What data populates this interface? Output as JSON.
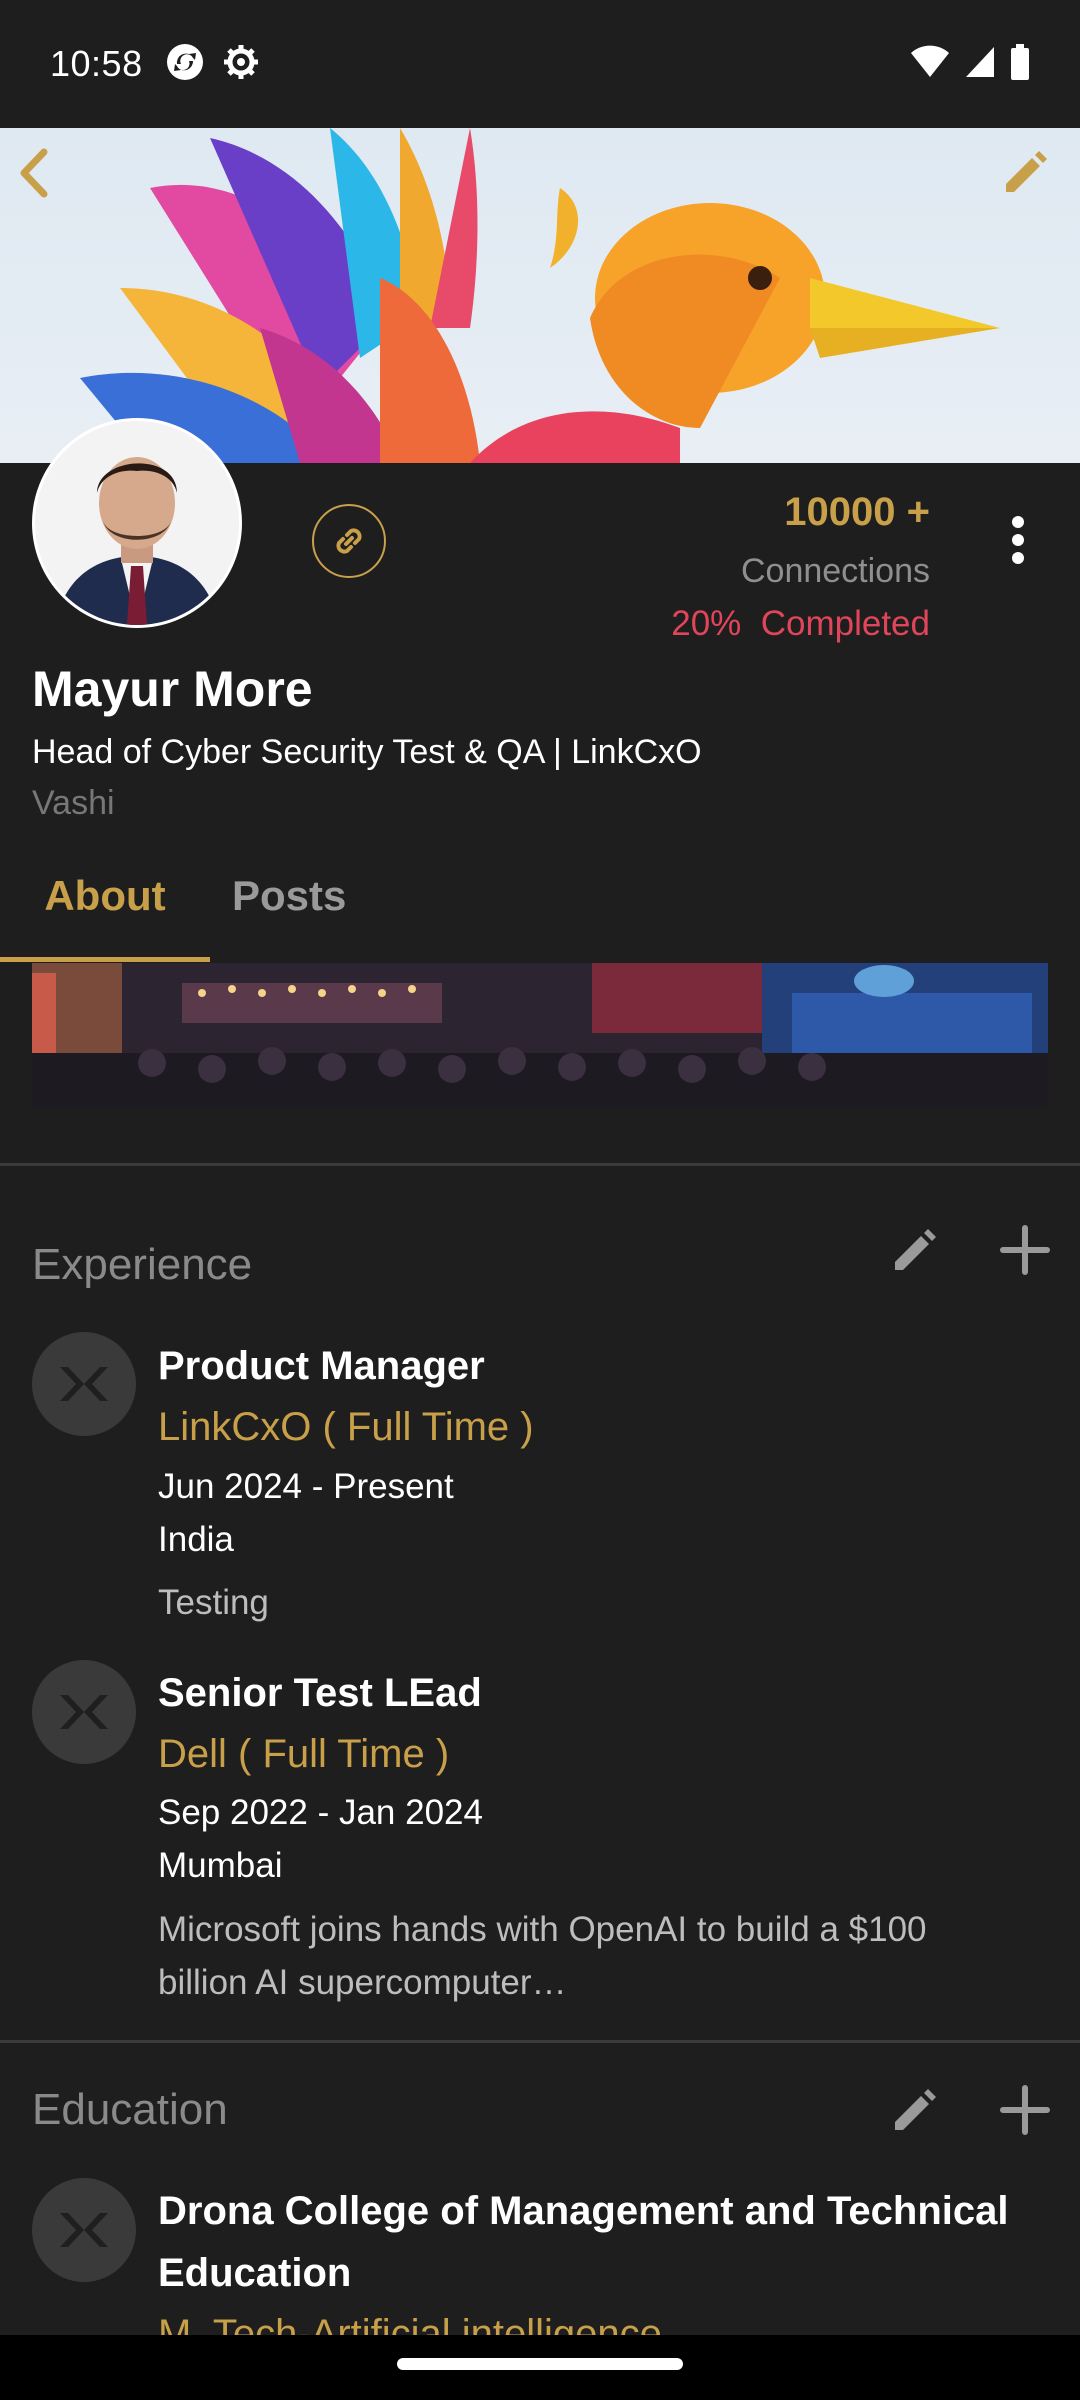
{
  "status_bar": {
    "time": "10:58"
  },
  "profile": {
    "connections_count": "10000 +",
    "connections_label": "Connections",
    "completion": "20%  Completed",
    "name": "Mayur More",
    "headline": "Head of Cyber Security Test & QA | LinkCxO",
    "location": "Vashi"
  },
  "tabs": [
    {
      "label": "About",
      "active": true
    },
    {
      "label": "Posts",
      "active": false
    }
  ],
  "experience": {
    "title": "Experience",
    "items": [
      {
        "role": "Product Manager",
        "company": "LinkCxO ( Full Time )",
        "dates": "Jun 2024 - Present",
        "place": "India",
        "description": "Testing"
      },
      {
        "role": "Senior Test LEad",
        "company": "Dell ( Full Time )",
        "dates": "Sep 2022 - Jan 2024",
        "place": "Mumbai",
        "description": "Microsoft joins hands with OpenAI to build a $100 billion AI supercomputer…"
      }
    ]
  },
  "education": {
    "title": "Education",
    "items": [
      {
        "school": "Drona College of Management and Technical Education",
        "degree": "M. Tech-Artificial intelligence"
      }
    ]
  },
  "colors": {
    "accent": "#c9a04a",
    "completion": "#e0455a",
    "background": "#1e1e1e"
  }
}
